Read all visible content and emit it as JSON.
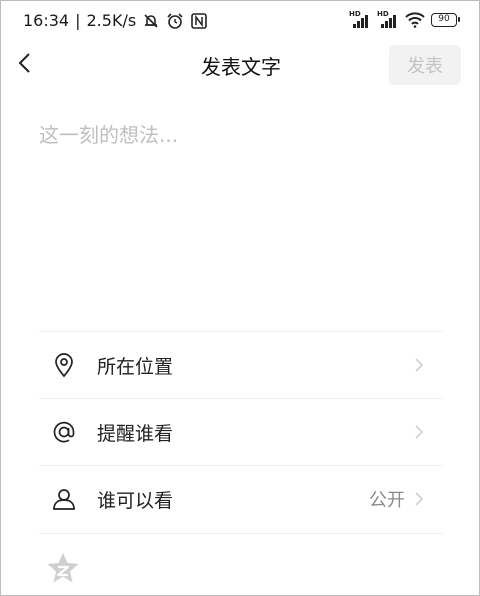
{
  "status_bar": {
    "time": "16:34",
    "separator": "|",
    "net_speed": "2.5K/s",
    "icons": [
      "bell-mute-icon",
      "alarm-icon",
      "nfc-icon"
    ],
    "right_icons": [
      "hd-signal-1-icon",
      "hd-signal-2-icon",
      "wifi-icon",
      "battery-icon"
    ],
    "signal_label": "HD",
    "battery_level": "90"
  },
  "nav": {
    "title": "发表文字",
    "publish_label": "发表",
    "back_icon": "chevron-left-icon"
  },
  "compose": {
    "placeholder": "这一刻的想法...",
    "value": ""
  },
  "options": [
    {
      "icon": "location-pin-icon",
      "label": "所在位置",
      "value": ""
    },
    {
      "icon": "at-sign-icon",
      "label": "提醒谁看",
      "value": ""
    },
    {
      "icon": "person-icon",
      "label": "谁可以看",
      "value": "公开"
    }
  ],
  "bottom": {
    "icon": "qzone-star-icon"
  },
  "colors": {
    "placeholder": "#bfbfbf",
    "publish_disabled_bg": "#f2f2f2",
    "publish_disabled_text": "#c4c4c4",
    "divider": "#eeeeee",
    "secondary_text": "#8a8a8a"
  }
}
